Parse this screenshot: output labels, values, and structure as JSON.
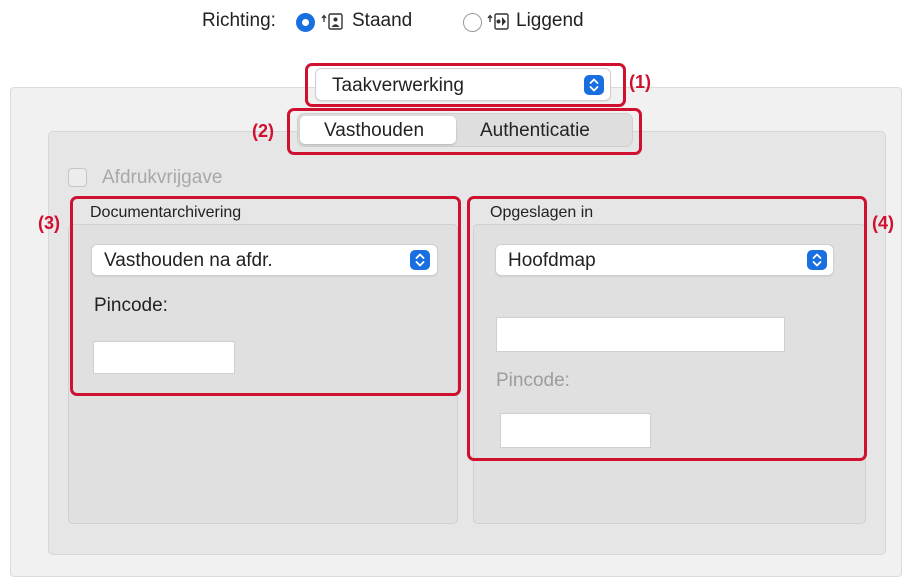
{
  "orientation": {
    "label": "Richting:",
    "options": [
      {
        "label": "Staand",
        "selected": true,
        "icon": "portrait-icon"
      },
      {
        "label": "Liggend",
        "selected": false,
        "icon": "landscape-icon"
      }
    ]
  },
  "menu_popup": {
    "value": "Taakverwerking"
  },
  "tabs": [
    {
      "label": "Vasthouden",
      "selected": true
    },
    {
      "label": "Authenticatie",
      "selected": false
    }
  ],
  "release_checkbox": {
    "label": "Afdrukvrijgave",
    "checked": false,
    "enabled": false
  },
  "document_archiving": {
    "title": "Documentarchivering",
    "select_value": "Vasthouden na afdr.",
    "pin_label": "Pincode:",
    "pin_value": ""
  },
  "saved_in": {
    "title": "Opgeslagen in",
    "select_value": "Hoofdmap",
    "folder_value": "",
    "pin_label": "Pincode:",
    "pin_value": ""
  },
  "callouts": {
    "c1": "(1)",
    "c2": "(2)",
    "c3": "(3)",
    "c4": "(4)"
  },
  "colors": {
    "accent": "#1a6fe0",
    "annotation": "#d0102f"
  }
}
